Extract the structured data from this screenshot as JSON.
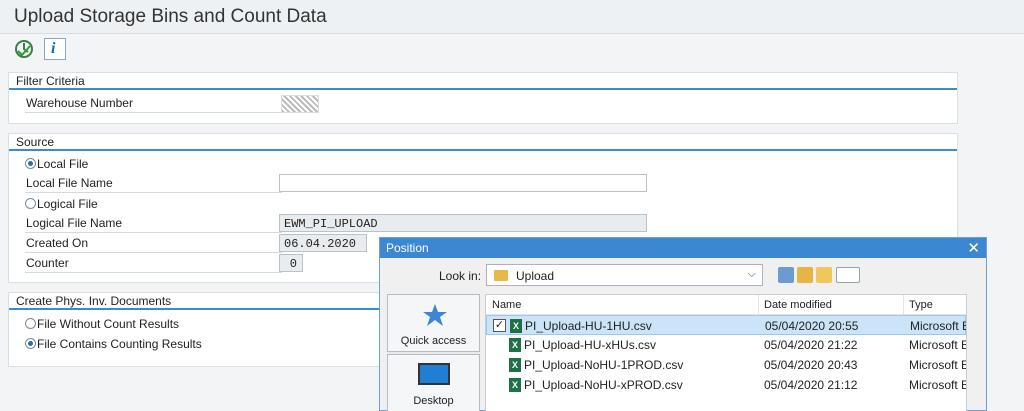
{
  "page": {
    "title": "Upload Storage Bins and Count Data"
  },
  "filter": {
    "heading": "Filter Criteria",
    "warehouse_label": "Warehouse Number"
  },
  "source": {
    "heading": "Source",
    "local_file": "Local File",
    "local_file_name_label": "Local File Name",
    "local_file_name_value": "",
    "logical_file": "Logical File",
    "logical_file_name_label": "Logical File Name",
    "logical_file_name_value": "EWM_PI_UPLOAD",
    "created_on_label": "Created On",
    "created_on_value": "06.04.2020",
    "counter_label": "Counter",
    "counter_value": "0",
    "selected": "Local File"
  },
  "create_docs": {
    "heading": "Create Phys. Inv. Documents",
    "option1": "File Without Count Results",
    "option2": "File Contains Counting Results",
    "selected": "File Contains Counting Results"
  },
  "dialog": {
    "title": "Position",
    "look_in_label": "Look in:",
    "look_in_value": "Upload",
    "places": [
      "Quick access",
      "Desktop"
    ],
    "columns": [
      "Name",
      "Date modified",
      "Type"
    ],
    "files": [
      {
        "name": "PI_Upload-HU-1HU.csv",
        "modified": "05/04/2020 20:55",
        "type": "Microsoft E",
        "selected": true
      },
      {
        "name": "PI_Upload-HU-xHUs.csv",
        "modified": "05/04/2020 21:22",
        "type": "Microsoft E",
        "selected": false
      },
      {
        "name": "PI_Upload-NoHU-1PROD.csv",
        "modified": "05/04/2020 20:43",
        "type": "Microsoft E",
        "selected": false
      },
      {
        "name": "PI_Upload-NoHU-xPROD.csv",
        "modified": "05/04/2020 21:12",
        "type": "Microsoft E",
        "selected": false
      }
    ]
  },
  "colors": {
    "accent": "#3b8ccf",
    "dialog_title": "#3c87d1",
    "selection": "#cce4f7"
  }
}
